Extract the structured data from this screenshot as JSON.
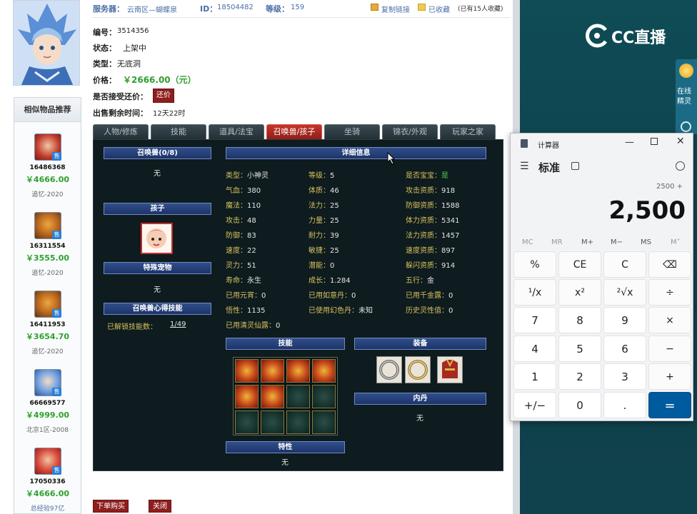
{
  "header": {
    "server_label": "服务器：",
    "server_value": "云南区—蝴蝶泉",
    "id_label": "ID：",
    "id_value": "18504482",
    "level_label": "等级：",
    "level_value": "159",
    "copy_link": "复制链接",
    "favorited": "已收藏",
    "fav_count": "(已有15人收藏)"
  },
  "info": {
    "number_label": "编号：",
    "number_value": "3514356",
    "status_label": "状态：",
    "status_value": "上架中",
    "type_label": "类型：",
    "type_value": "无底洞",
    "price_label": "价格：",
    "price_value": "￥2666.00（元）",
    "bargain_label": "是否接受还价：",
    "bargain_button": "还价",
    "time_label": "出售剩余时间：",
    "time_value": "12天22时"
  },
  "similar": {
    "title": "相似物品推荐",
    "badge": "售",
    "items": [
      {
        "id": "16486368",
        "price": "￥4666.00",
        "server": "追忆-2020"
      },
      {
        "id": "16311554",
        "price": "￥3555.00",
        "server": "追忆-2020"
      },
      {
        "id": "16411953",
        "price": "￥3654.70",
        "server": "追忆-2020"
      },
      {
        "id": "66669577",
        "price": "￥4999.00",
        "server": "北京1区-2008"
      },
      {
        "id": "17050336",
        "price": "￥4666.00",
        "server": "总经验97亿"
      }
    ]
  },
  "tabs": [
    "人物/修炼",
    "技能",
    "道具/法宝",
    "召唤兽/孩子",
    "坐骑",
    "锦衣/外观",
    "玩家之家"
  ],
  "panel": {
    "pets_header": "召唤兽(0/8)",
    "pets_value": "无",
    "child_header": "孩子",
    "special_pet_header": "特殊宠物",
    "special_pet_value": "无",
    "heart_skill_header": "召唤兽心得技能",
    "unlocked_label": "已解锁技能数：",
    "unlocked_value": "1/49",
    "detail_header": "详细信息",
    "col1": [
      {
        "label": "类型：",
        "value": "小神灵"
      },
      {
        "label": "气血：",
        "value": "380"
      },
      {
        "label": "魔法：",
        "value": "110"
      },
      {
        "label": "攻击：",
        "value": "48"
      },
      {
        "label": "防御：",
        "value": "83"
      },
      {
        "label": "速度：",
        "value": "22"
      },
      {
        "label": "灵力：",
        "value": "51"
      },
      {
        "label": "寿命：",
        "value": "永生"
      },
      {
        "label": "已用元宵：",
        "value": "0"
      },
      {
        "label": "悟性：",
        "value": "1135"
      },
      {
        "label": "已用清灵仙露：",
        "value": "0"
      }
    ],
    "col2": [
      {
        "label": "等级：",
        "value": "5"
      },
      {
        "label": "体质：",
        "value": "46"
      },
      {
        "label": "法力：",
        "value": "25"
      },
      {
        "label": "力量：",
        "value": "25"
      },
      {
        "label": "耐力：",
        "value": "39"
      },
      {
        "label": "敏捷：",
        "value": "25"
      },
      {
        "label": "潜能：",
        "value": "0"
      },
      {
        "label": "成长：",
        "value": "1.284"
      },
      {
        "label": "已用如意丹：",
        "value": "0"
      },
      {
        "label": "已使用幻色丹：",
        "value": "未知"
      }
    ],
    "col3": [
      {
        "label": "是否宝宝：",
        "value": "是"
      },
      {
        "label": "攻击资质：",
        "value": "918"
      },
      {
        "label": "防御资质：",
        "value": "1588"
      },
      {
        "label": "体力资质：",
        "value": "5341"
      },
      {
        "label": "法力资质：",
        "value": "1457"
      },
      {
        "label": "速度资质：",
        "value": "897"
      },
      {
        "label": "躲闪资质：",
        "value": "914"
      },
      {
        "label": "五行：",
        "value": "金"
      },
      {
        "label": "已用千金露：",
        "value": "0"
      },
      {
        "label": "历史灵性值：",
        "value": "0"
      }
    ],
    "skills_header": "技能",
    "equip_header": "装备",
    "inner_dan_header": "内丹",
    "inner_dan_value": "无",
    "trait_header": "特性",
    "trait_value": "无"
  },
  "bottom": {
    "buy_button": "下单购买",
    "close_button": "关闭"
  },
  "overlay": {
    "cc_logo": "CC直播",
    "side_online": "在线",
    "side_sprite": "精灵"
  },
  "calculator": {
    "title": "计算器",
    "mode": "标准",
    "expression": "2500 +",
    "display": "2,500",
    "memory": [
      "MC",
      "MR",
      "M+",
      "M−",
      "MS",
      "M˅"
    ],
    "keys": [
      [
        "%",
        "CE",
        "C",
        "⌫"
      ],
      [
        "¹/x",
        "x²",
        "²√x",
        "÷"
      ],
      [
        "7",
        "8",
        "9",
        "×"
      ],
      [
        "4",
        "5",
        "6",
        "−"
      ],
      [
        "1",
        "2",
        "3",
        "+"
      ],
      [
        "+/−",
        "0",
        ".",
        "="
      ]
    ]
  },
  "colors": {
    "price_green": "#2ea12e",
    "label_gold": "#d5c25c",
    "accent_blue": "#005a9e",
    "tab_active": "#c4362c"
  }
}
